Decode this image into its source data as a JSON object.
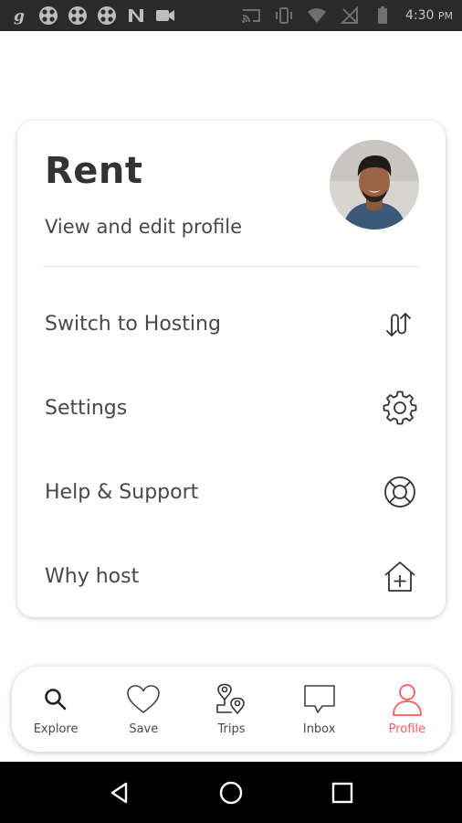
{
  "status_bar": {
    "time": "4:30",
    "time_suffix": "PM",
    "icons": [
      "g-notification-icon",
      "apps-icon",
      "apps-icon",
      "apps-icon",
      "n-icon",
      "video-icon",
      "cast-icon",
      "vibrate-icon",
      "wifi-icon",
      "no-signal-icon",
      "battery-icon"
    ]
  },
  "profile": {
    "title": "Rent",
    "subtitle": "View and edit profile"
  },
  "menu": {
    "items": [
      {
        "label": "Switch to Hosting",
        "icon": "switch-arrows-icon"
      },
      {
        "label": "Settings",
        "icon": "gear-icon"
      },
      {
        "label": "Help & Support",
        "icon": "lifebuoy-icon"
      },
      {
        "label": "Why host",
        "icon": "house-plus-icon"
      }
    ]
  },
  "bottom_nav": {
    "tabs": [
      {
        "label": "Explore",
        "icon": "search-icon"
      },
      {
        "label": "Save",
        "icon": "heart-icon"
      },
      {
        "label": "Trips",
        "icon": "trips-icon"
      },
      {
        "label": "Inbox",
        "icon": "chat-bubble-icon"
      },
      {
        "label": "Profile",
        "icon": "person-icon",
        "active": true
      }
    ]
  },
  "colors": {
    "accent": "#ff5a5f",
    "text": "#484848",
    "title": "#333333",
    "status_bar": "#2a2a2a"
  },
  "android_nav": [
    "back-icon",
    "home-icon",
    "recents-icon"
  ]
}
